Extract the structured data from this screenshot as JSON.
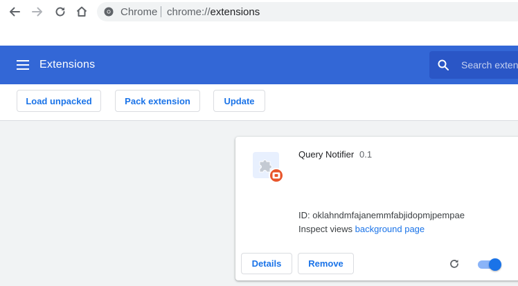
{
  "browser": {
    "omnibox_chip": "Chrome",
    "url_prefix": "chrome://",
    "url_path": "extensions"
  },
  "header": {
    "title": "Extensions",
    "search_placeholder": "Search extensions"
  },
  "toolbar": {
    "load_unpacked_label": "Load unpacked",
    "pack_extension_label": "Pack extension",
    "update_label": "Update"
  },
  "extension": {
    "name": "Query Notifier",
    "version": "0.1",
    "id_label": "ID:",
    "id": "oklahndmfajanemmfabjidopmjpempae",
    "inspect_label": "Inspect views",
    "inspect_link": "background page",
    "details_label": "Details",
    "remove_label": "Remove",
    "enabled": true,
    "icon": "puzzle-piece-icon",
    "badge_icon": "error-badge-icon"
  },
  "colors": {
    "header_bg": "#3367d6",
    "accent": "#1a73e8",
    "badge": "#e8552b"
  }
}
